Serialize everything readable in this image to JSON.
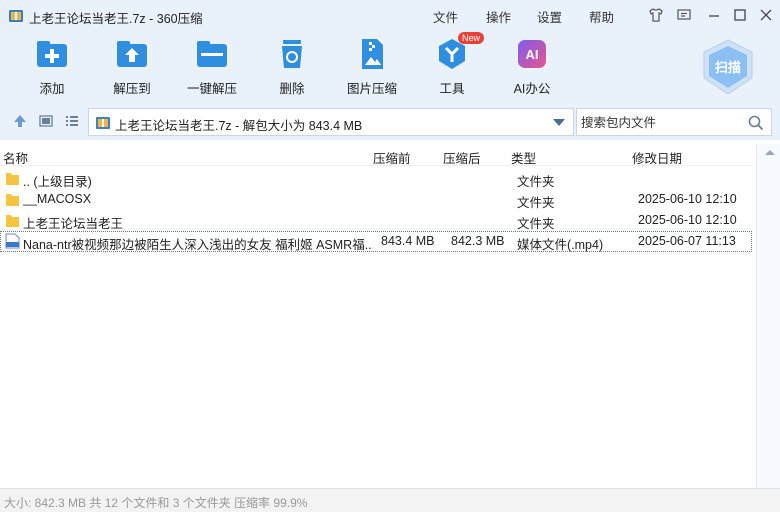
{
  "window": {
    "title": "上老王论坛当老王.7z - 360压缩",
    "menus": [
      "文件",
      "操作",
      "设置",
      "帮助"
    ]
  },
  "toolbar": {
    "items": [
      {
        "label": "添加",
        "icon": "add-icon"
      },
      {
        "label": "解压到",
        "icon": "extract-to-icon"
      },
      {
        "label": "一键解压",
        "icon": "one-click-extract-icon"
      },
      {
        "label": "删除",
        "icon": "delete-icon"
      },
      {
        "label": "图片压缩",
        "icon": "image-compress-icon"
      },
      {
        "label": "工具",
        "icon": "tools-icon",
        "badge": "New"
      },
      {
        "label": "AI办公",
        "icon": "ai-office-icon",
        "icon_text": "AI"
      }
    ],
    "scan_label": "扫描"
  },
  "address": {
    "path": "上老王论坛当老王.7z - 解包大小为 843.4 MB",
    "search_placeholder": "搜索包内文件"
  },
  "columns": [
    "名称",
    "压缩前",
    "压缩后",
    "类型",
    "修改日期"
  ],
  "rows": [
    {
      "name": ".. (上级目录)",
      "before": "",
      "after": "",
      "type": "文件夹",
      "date": "",
      "icon": "folder-icon"
    },
    {
      "name": "__MACOSX",
      "before": "",
      "after": "",
      "type": "文件夹",
      "date": "2025-06-10 12:10",
      "icon": "folder-icon"
    },
    {
      "name": "上老王论坛当老王",
      "before": "",
      "after": "",
      "type": "文件夹",
      "date": "2025-06-10 12:10",
      "icon": "folder-icon"
    },
    {
      "name": "Nana-ntr被视频那边被陌生人深入浅出的女友 福利姬 ASMR福...",
      "before": "843.4 MB",
      "after": "842.3 MB",
      "type": "媒体文件(.mp4)",
      "date": "2025-06-07 11:13",
      "icon": "mp4-file-icon"
    }
  ],
  "status": "大小: 842.3 MB 共 12 个文件和 3 个文件夹 压缩率 99.9%",
  "colors": {
    "accent": "#2f8ee0",
    "bar_bg": "#e9f1fb",
    "folder": "#f5c542"
  }
}
